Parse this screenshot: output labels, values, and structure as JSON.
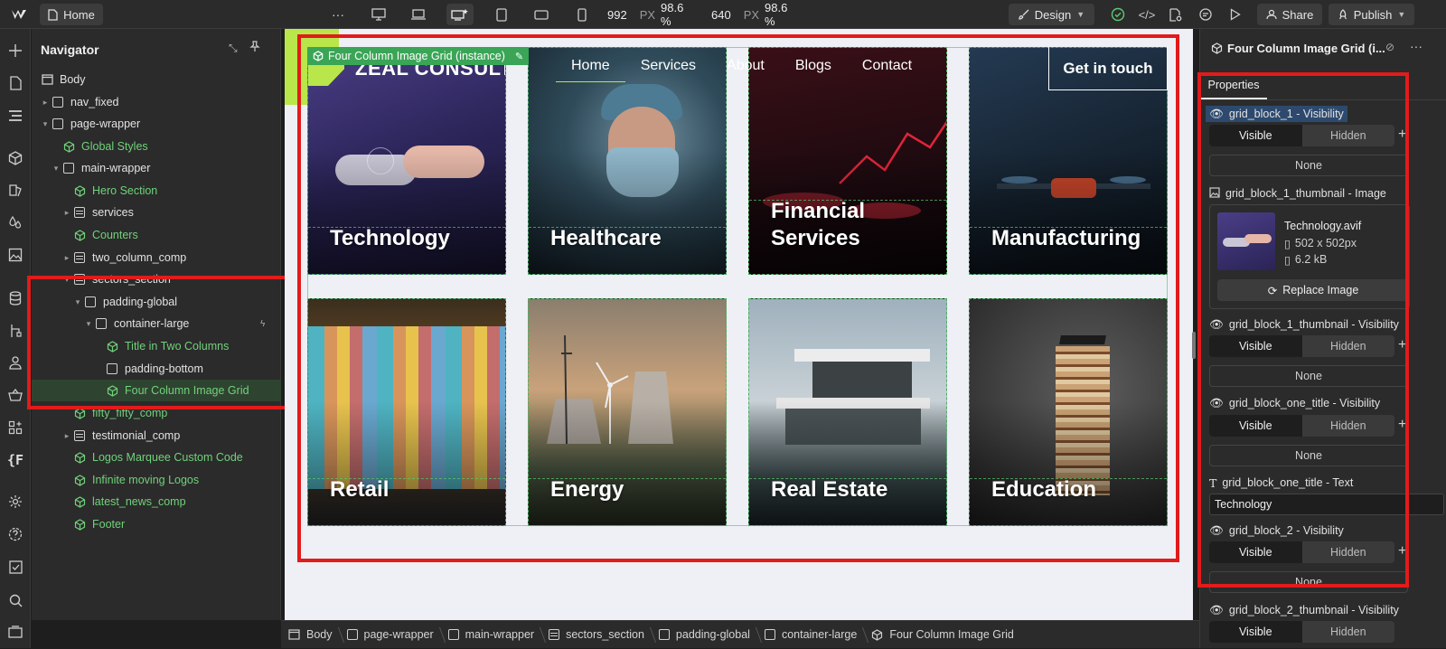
{
  "topbar": {
    "home_label": "Home",
    "more_glyph": "···",
    "width_value": "992",
    "width_unit": "PX",
    "width_zoom": "98.6 %",
    "height_value": "640",
    "height_unit": "PX",
    "height_zoom": "98.6 %",
    "mode_label": "Design",
    "share_label": "Share",
    "publish_label": "Publish"
  },
  "navigator": {
    "title": "Navigator",
    "items": [
      {
        "label": "Body"
      },
      {
        "label": "nav_fixed"
      },
      {
        "label": "page-wrapper"
      },
      {
        "label": "Global Styles"
      },
      {
        "label": "main-wrapper"
      },
      {
        "label": "Hero Section"
      },
      {
        "label": "services"
      },
      {
        "label": "Counters"
      },
      {
        "label": "two_column_comp"
      },
      {
        "label": "sectors_section"
      },
      {
        "label": "padding-global"
      },
      {
        "label": "container-large"
      },
      {
        "label": "Title in Two Columns"
      },
      {
        "label": "padding-bottom"
      },
      {
        "label": "Four Column Image Grid"
      },
      {
        "label": "fifty_fifty_comp"
      },
      {
        "label": "testimonial_comp"
      },
      {
        "label": "Logos Marquee Custom Code"
      },
      {
        "label": "Infinite moving Logos"
      },
      {
        "label": "latest_news_comp"
      },
      {
        "label": "Footer"
      }
    ]
  },
  "canvas": {
    "instance_badge": "Four Column Image Grid (instance)",
    "logo_text": "ZEAL CONSULT",
    "nav_links": [
      "Home",
      "Services",
      "About",
      "Blogs",
      "Contact"
    ],
    "cta": "Get in touch",
    "cells": [
      {
        "title": "Technology"
      },
      {
        "title": "Healthcare"
      },
      {
        "title": "Financial Services"
      },
      {
        "title": "Manufacturing"
      },
      {
        "title": "Retail"
      },
      {
        "title": "Energy"
      },
      {
        "title": "Real Estate"
      },
      {
        "title": "Education"
      }
    ]
  },
  "breadcrumb": [
    "Body",
    "page-wrapper",
    "main-wrapper",
    "sectors_section",
    "padding-global",
    "container-large",
    "Four Column Image Grid"
  ],
  "panel": {
    "title": "Four Column Image Grid (i...",
    "tab": "Properties",
    "visible": "Visible",
    "hidden": "Hidden",
    "none": "None",
    "p1": "grid_block_1 - Visibility",
    "p2": "grid_block_1_thumbnail - Image",
    "file_name": "Technology.avif",
    "file_dims": "502 x 502px",
    "file_size": "6.2 kB",
    "replace": "Replace Image",
    "p3": "grid_block_1_thumbnail - Visibility",
    "p4": "grid_block_one_title - Visibility",
    "p5": "grid_block_one_title - Text",
    "text_value": "Technology",
    "p6": "grid_block_2 - Visibility",
    "p7": "grid_block_2_thumbnail - Visibility"
  },
  "colors": {
    "accent_green": "#70d27a",
    "highlight_red": "#e21b1b",
    "lime": "#b9e64a"
  }
}
